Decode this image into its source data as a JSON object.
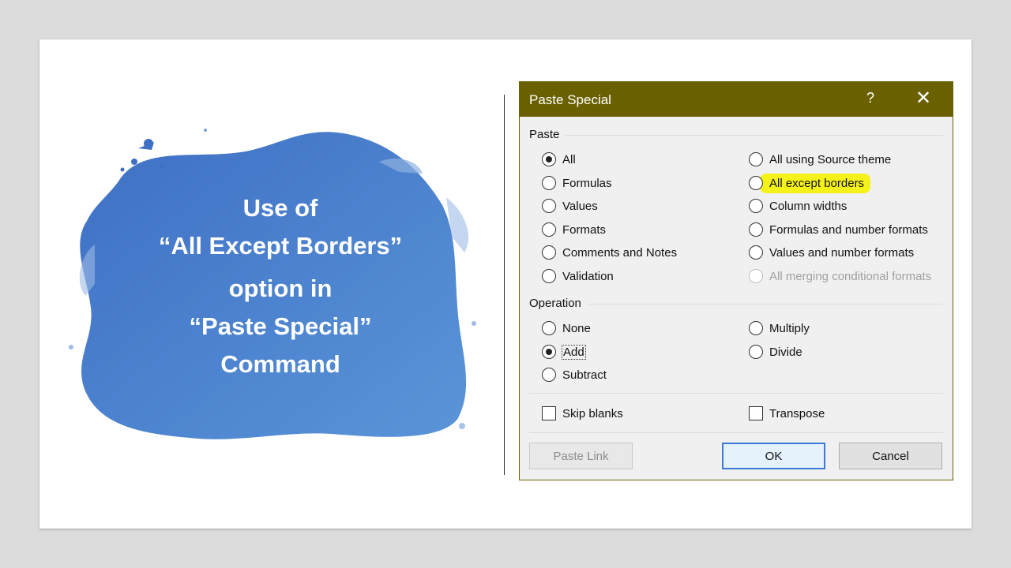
{
  "slide": {
    "heading_lines": [
      "Use of",
      "“All Except Borders”",
      "option in",
      "“Paste Special”",
      "Command"
    ],
    "splash_color": "#4a7fcf"
  },
  "dialog": {
    "title": "Paste Special",
    "help_label": "?",
    "close_label": "✕",
    "titlebar_color": "#6b6000",
    "paste_group": {
      "label": "Paste",
      "left_options": [
        {
          "label": "All",
          "checked": true
        },
        {
          "label": "Formulas",
          "checked": false
        },
        {
          "label": "Values",
          "checked": false
        },
        {
          "label": "Formats",
          "checked": false
        },
        {
          "label": "Comments and Notes",
          "checked": false
        },
        {
          "label": "Validation",
          "checked": false
        }
      ],
      "right_options": [
        {
          "label": "All using Source theme",
          "checked": false
        },
        {
          "label": "All except borders",
          "checked": false,
          "highlighted": true
        },
        {
          "label": "Column widths",
          "checked": false
        },
        {
          "label": "Formulas and number formats",
          "checked": false
        },
        {
          "label": "Values and number formats",
          "checked": false
        },
        {
          "label": "All merging conditional formats",
          "checked": false,
          "disabled": true
        }
      ]
    },
    "operation_group": {
      "label": "Operation",
      "left_options": [
        {
          "label": "None",
          "checked": false
        },
        {
          "label": "Add",
          "checked": true
        },
        {
          "label": "Subtract",
          "checked": false
        }
      ],
      "right_options": [
        {
          "label": "Multiply",
          "checked": false
        },
        {
          "label": "Divide",
          "checked": false
        }
      ]
    },
    "checkboxes": {
      "skip_blanks": "Skip blanks",
      "transpose": "Transpose"
    },
    "buttons": {
      "paste_link": "Paste Link",
      "ok": "OK",
      "cancel": "Cancel"
    },
    "highlight_color": "#f5f21a"
  }
}
